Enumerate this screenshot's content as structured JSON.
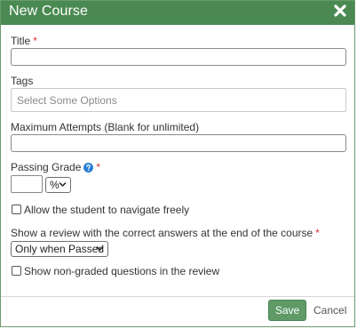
{
  "dialog": {
    "title": "New Course",
    "close_icon": "close-x-icon"
  },
  "fields": {
    "title_label": "Title",
    "title_value": "",
    "required_mark": "*",
    "tags_label": "Tags",
    "tags_placeholder": "Select Some Options",
    "max_attempts_label": "Maximum Attempts (Blank for unlimited)",
    "max_attempts_value": "",
    "passing_grade_label": "Passing Grade",
    "passing_grade_value": "",
    "help_icon": "question-circle-icon",
    "grade_unit": "%",
    "navigate_freely_label": "Allow the student to navigate freely",
    "navigate_freely_checked": false,
    "review_label": "Show a review with the correct answers at the end of the course",
    "review_option": "Only when Passed",
    "non_graded_label": "Show non-graded questions in the review",
    "non_graded_checked": false
  },
  "actions": {
    "save_label": "Save",
    "cancel_label": "Cancel"
  },
  "colors": {
    "titlebar": "#4a8a52",
    "save_button": "#5f9a67",
    "required": "#d9302b",
    "help_icon": "#2a7fd4"
  }
}
